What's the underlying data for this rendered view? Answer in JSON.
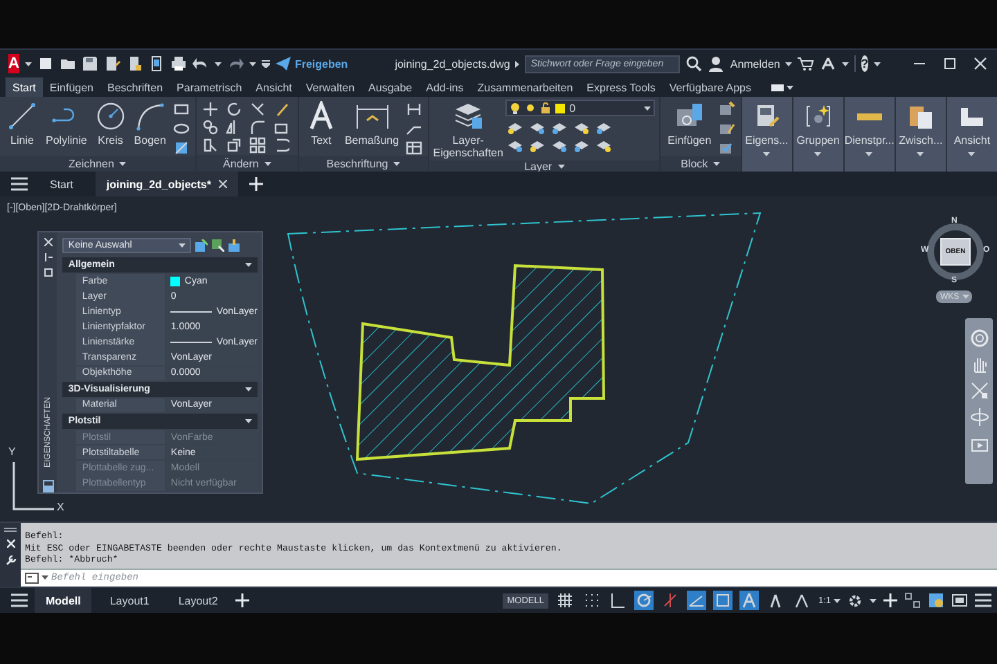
{
  "title_bar": {
    "logo": "A",
    "share": "Freigeben",
    "file_name": "joining_2d_objects.dwg",
    "search": {
      "placeholder": "Stichwort oder Frage eingeben"
    },
    "sign_in": "Anmelden",
    "help": "?"
  },
  "ribbon_tabs": [
    {
      "label": "Start",
      "selected": true
    },
    {
      "label": "Einfügen",
      "selected": false
    },
    {
      "label": "Beschriften",
      "selected": false
    },
    {
      "label": "Parametrisch",
      "selected": false
    },
    {
      "label": "Ansicht",
      "selected": false
    },
    {
      "label": "Verwalten",
      "selected": false
    },
    {
      "label": "Ausgabe",
      "selected": false
    },
    {
      "label": "Add-ins",
      "selected": false
    },
    {
      "label": "Zusammenarbeiten",
      "selected": false
    },
    {
      "label": "Express Tools",
      "selected": false
    },
    {
      "label": "Verfügbare Apps",
      "selected": false
    }
  ],
  "ribbon_panels": [
    {
      "kind": "draw",
      "title": "Zeichnen",
      "tools": [
        "Linie",
        "Polylinie",
        "Kreis",
        "Bogen"
      ]
    },
    {
      "kind": "modify",
      "title": "Ändern"
    },
    {
      "kind": "annotate",
      "title": "Beschriftung",
      "tools": [
        "Text",
        "Bemaßung"
      ]
    },
    {
      "kind": "layer",
      "title": "Layer",
      "tools": [
        "Layer-Eigenschaften"
      ],
      "current_layer": "0"
    },
    {
      "kind": "block",
      "title": "Block",
      "tools": [
        "Einfügen"
      ]
    }
  ],
  "collapsed_panels": [
    "Eigens...",
    "Gruppen",
    "Dienstpr...",
    "Zwisch...",
    "Ansicht"
  ],
  "file_tabs": [
    {
      "label": "Start",
      "selected": false
    },
    {
      "label": "joining_2d_objects*",
      "selected": true
    }
  ],
  "viewport": {
    "label": "[-][Oben][2D-Drahtkörper]",
    "viewcube": {
      "face": "OBEN",
      "north": "N",
      "south": "S",
      "west": "W",
      "east": "O"
    },
    "ucs_menu": "WKS",
    "ucs_icon": {
      "x": "X",
      "y": "Y"
    }
  },
  "properties": {
    "title": "EIGENSCHAFTEN",
    "selection": "Keine Auswahl",
    "sections": [
      {
        "title": "Allgemein",
        "rows": [
          {
            "label": "Farbe",
            "value": "Cyan",
            "kind": "color",
            "color": "#00ffff",
            "disabled": false
          },
          {
            "label": "Layer",
            "value": "0",
            "kind": "text",
            "disabled": false
          },
          {
            "label": "Linientyp",
            "value": "VonLayer",
            "kind": "line",
            "disabled": false
          },
          {
            "label": "Linientypfaktor",
            "value": "1.0000",
            "kind": "text",
            "disabled": false
          },
          {
            "label": "Linienstärke",
            "value": "VonLayer",
            "kind": "line",
            "disabled": false
          },
          {
            "label": "Transparenz",
            "value": "VonLayer",
            "kind": "text",
            "disabled": false
          },
          {
            "label": "Objekthöhe",
            "value": "0.0000",
            "kind": "text",
            "disabled": false
          }
        ]
      },
      {
        "title": "3D-Visualisierung",
        "rows": [
          {
            "label": "Material",
            "value": "VonLayer",
            "kind": "text",
            "disabled": false
          }
        ]
      },
      {
        "title": "Plotstil",
        "rows": [
          {
            "label": "Plotstil",
            "value": "VonFarbe",
            "kind": "text",
            "disabled": true
          },
          {
            "label": "Plotstiltabelle",
            "value": "Keine",
            "kind": "text",
            "disabled": false
          },
          {
            "label": "Plottabelle zug...",
            "value": "Modell",
            "kind": "text",
            "disabled": true
          },
          {
            "label": "Plottabellentyp",
            "value": "Nicht verfügbar",
            "kind": "text",
            "disabled": true
          }
        ]
      }
    ]
  },
  "command_line": {
    "history": [
      "Befehl:",
      "Mit ESC oder EINGABETASTE beenden oder rechte Maustaste klicken, um das Kontextmenü zu aktivieren.",
      "Befehl: *Abbruch*"
    ],
    "placeholder": "Befehl eingeben"
  },
  "layout_tabs": [
    {
      "label": "Modell",
      "selected": true
    },
    {
      "label": "Layout1",
      "selected": false
    },
    {
      "label": "Layout2",
      "selected": false
    }
  ],
  "status_bar": {
    "space": "MODELL",
    "toggles": [
      {
        "kind": "grid",
        "on": false
      },
      {
        "kind": "snap",
        "on": false
      },
      {
        "kind": "ortho",
        "on": false
      },
      {
        "kind": "polar",
        "on": true
      },
      {
        "kind": "isodraft",
        "on": false
      },
      {
        "kind": "tracking",
        "on": true
      },
      {
        "kind": "osnap",
        "on": true
      },
      {
        "kind": "annotation",
        "on": true
      },
      {
        "kind": "autoscale",
        "on": false
      },
      {
        "kind": "annoscale",
        "on": false
      }
    ],
    "scale": "1:1"
  }
}
